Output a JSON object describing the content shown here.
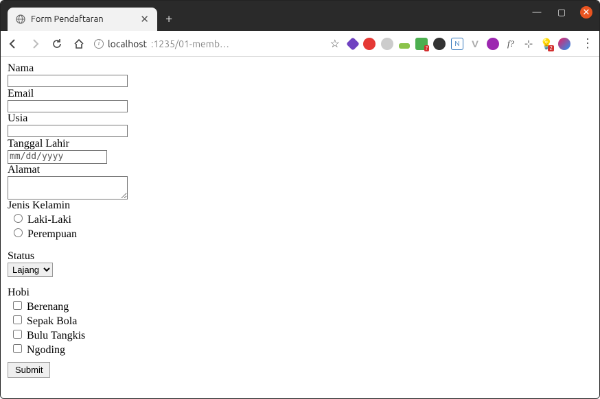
{
  "window": {
    "tab_title": "Form Pendaftaran",
    "new_tab": "+",
    "controls": {
      "min": "—",
      "max": "▢",
      "close": "✕"
    }
  },
  "toolbar": {
    "url_host": "localhost",
    "url_rest": ":1235/01-memb…",
    "star": "☆"
  },
  "extensions": {
    "badge1": "?",
    "badge2": "2",
    "n": "N",
    "v": "V",
    "fq": "f?",
    "leaf": "⊹",
    "bulb": "💡"
  },
  "form": {
    "nama_label": "Nama",
    "email_label": "Email",
    "usia_label": "Usia",
    "tanggal_label": "Tanggal Lahir",
    "date_placeholder": "mm/dd/yyyy",
    "alamat_label": "Alamat",
    "jk_label": "Jenis Kelamin",
    "jk_options": {
      "laki": "Laki-Laki",
      "perempuan": "Perempuan"
    },
    "status_label": "Status",
    "status_selected": "Lajang",
    "hobi_label": "Hobi",
    "hobi": {
      "berenang": "Berenang",
      "sepakbola": "Sepak Bola",
      "bulutangkis": "Bulu Tangkis",
      "ngoding": "Ngoding"
    },
    "submit": "Submit"
  }
}
